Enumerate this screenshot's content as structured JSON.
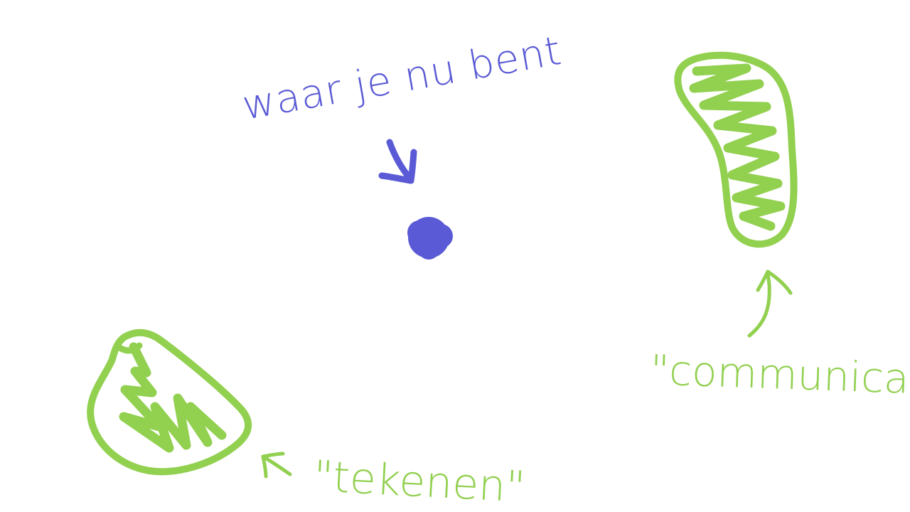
{
  "labels": {
    "current_location": "waar je nu bent",
    "drawing": "\"tekenen\"",
    "communication": "\"communicatie\""
  },
  "colors": {
    "background": "#ffffff",
    "ink_blue": "#5a5ad6",
    "ink_green": "#92d050"
  }
}
